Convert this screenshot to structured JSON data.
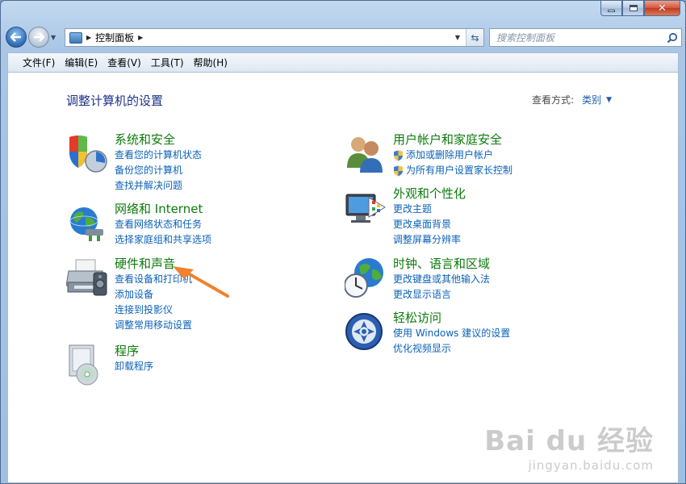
{
  "window": {
    "accent": "#a9c6e6"
  },
  "caption": {
    "min": "–",
    "max": "□",
    "close": "✕"
  },
  "address": {
    "path": "控制面板"
  },
  "search": {
    "placeholder": "搜索控制面板"
  },
  "menu": [
    "文件(F)",
    "编辑(E)",
    "查看(V)",
    "工具(T)",
    "帮助(H)"
  ],
  "page_title": "调整计算机的设置",
  "view_by": {
    "label": "查看方式:",
    "value": "类别"
  },
  "categories_left": [
    {
      "title": "系统和安全",
      "icon": "system-security-icon",
      "links": [
        "查看您的计算机状态",
        "备份您的计算机",
        "查找并解决问题"
      ]
    },
    {
      "title": "网络和 Internet",
      "icon": "network-globe-icon",
      "links": [
        "查看网络状态和任务",
        "选择家庭组和共享选项"
      ]
    },
    {
      "title": "硬件和声音",
      "icon": "printer-icon",
      "links": [
        "查看设备和打印机",
        "添加设备",
        "连接到投影仪",
        "调整常用移动设置"
      ]
    },
    {
      "title": "程序",
      "icon": "programs-disc-icon",
      "links": [
        "卸载程序"
      ]
    }
  ],
  "categories_right": [
    {
      "title": "用户帐户和家庭安全",
      "icon": "users-icon",
      "links": [
        "添加或删除用户帐户",
        "为所有用户设置家长控制"
      ]
    },
    {
      "title": "外观和个性化",
      "icon": "monitor-palette-icon",
      "links": [
        "更改主题",
        "更改桌面背景",
        "调整屏幕分辨率"
      ]
    },
    {
      "title": "时钟、语言和区域",
      "icon": "clock-globe-icon",
      "links": [
        "更改键盘或其他输入法",
        "更改显示语言"
      ]
    },
    {
      "title": "轻松访问",
      "icon": "ease-of-access-icon",
      "links": [
        "使用 Windows 建议的设置",
        "优化视频显示"
      ]
    }
  ],
  "watermark": {
    "main": "Bai du 经验",
    "sub": "jingyan.baidu.com"
  }
}
